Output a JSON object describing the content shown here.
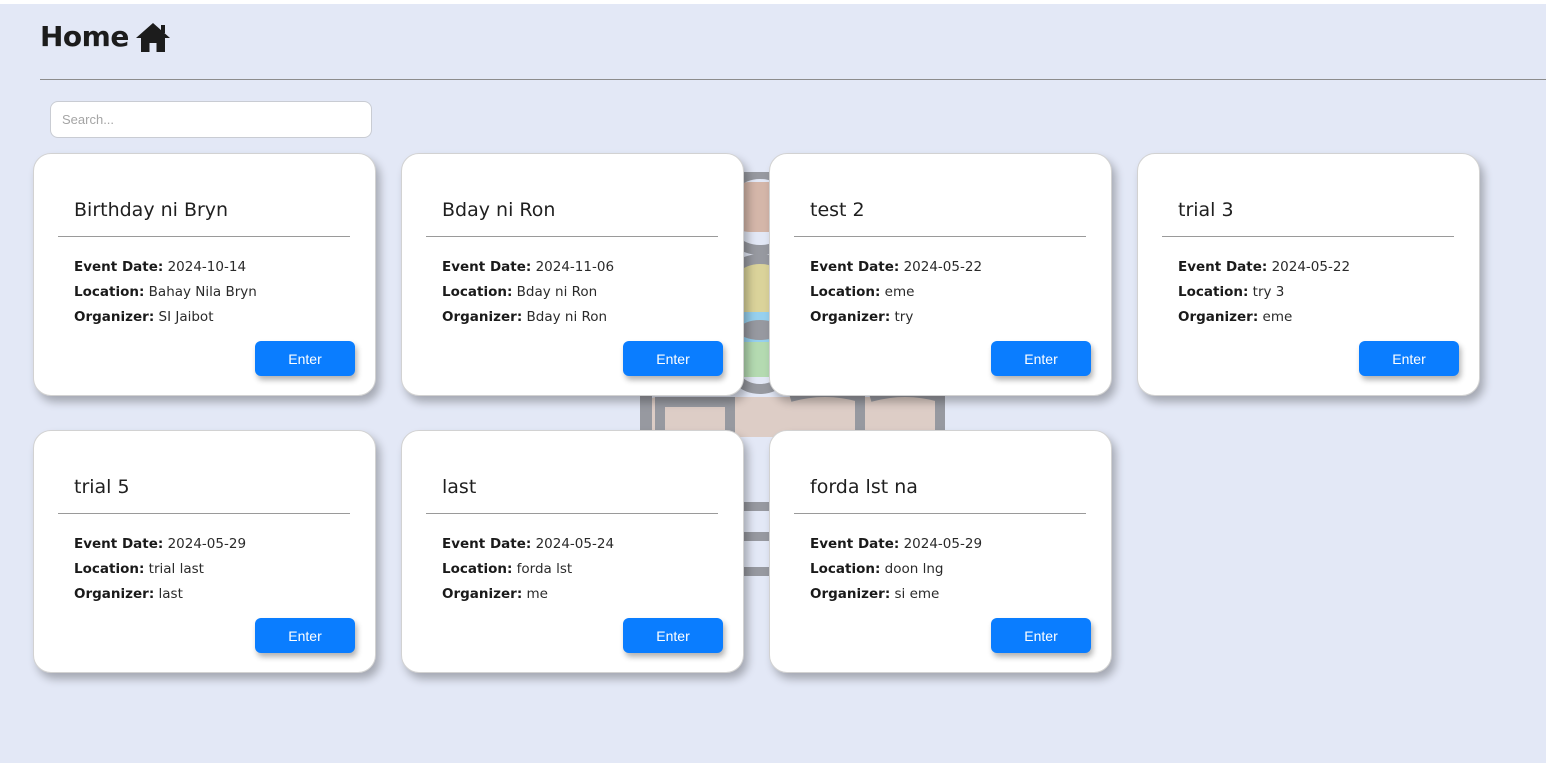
{
  "header": {
    "title": "Home",
    "icon": "home-icon"
  },
  "search": {
    "placeholder": "Search...",
    "value": ""
  },
  "labels": {
    "event_date": "Event Date:",
    "location": "Location:",
    "organizer": "Organizer:"
  },
  "colors": {
    "background": "#e3e8f6",
    "accent": "#0a7dff",
    "card": "#ffffff"
  },
  "events": [
    {
      "title": "Birthday ni Bryn",
      "event_date": "2024-10-14",
      "location": "Bahay Nila Bryn",
      "organizer": "SI Jaibot",
      "button": "Enter"
    },
    {
      "title": "Bday ni Ron",
      "event_date": "2024-11-06",
      "location": "Bday ni Ron",
      "organizer": "Bday ni Ron",
      "button": "Enter"
    },
    {
      "title": "test 2",
      "event_date": "2024-05-22",
      "location": "eme",
      "organizer": "try",
      "button": "Enter"
    },
    {
      "title": "trial 3",
      "event_date": "2024-05-22",
      "location": "try 3",
      "organizer": "eme",
      "button": "Enter"
    },
    {
      "title": "trial 5",
      "event_date": "2024-05-29",
      "location": "trial last",
      "organizer": "last",
      "button": "Enter"
    },
    {
      "title": "last",
      "event_date": "2024-05-24",
      "location": "forda lst",
      "organizer": "me",
      "button": "Enter"
    },
    {
      "title": "forda lst na",
      "event_date": "2024-05-29",
      "location": "doon lng",
      "organizer": "si eme",
      "button": "Enter"
    }
  ]
}
